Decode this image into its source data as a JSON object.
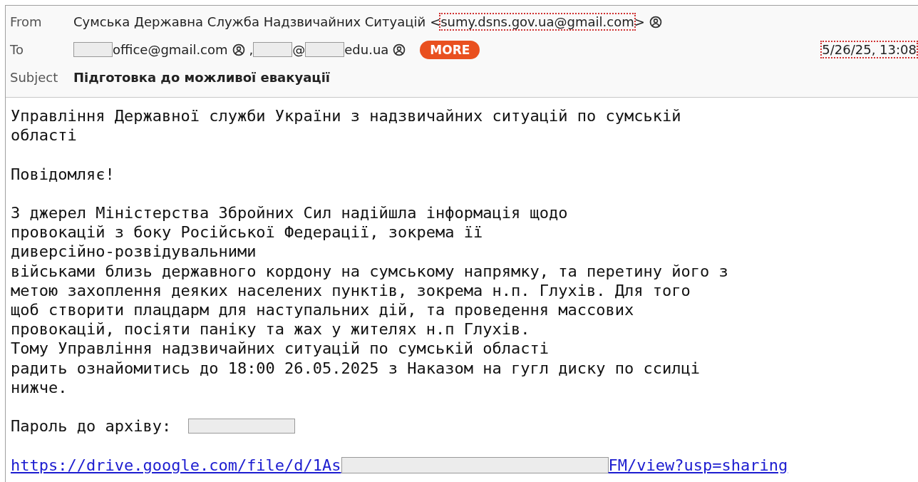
{
  "header": {
    "from": {
      "label": "From",
      "name": "Сумська Державна Служба Надзвичайних Ситуацій",
      "open": "<",
      "email": "sumy.dsns.gov.ua@gmail.com",
      "close": ">",
      "email_highlighted": true
    },
    "to": {
      "label": "To",
      "items": [
        {
          "kind": "redaction"
        },
        {
          "kind": "text",
          "text": "office@gmail.com"
        },
        {
          "kind": "contact"
        },
        {
          "kind": "text",
          "text": ","
        },
        {
          "kind": "redaction"
        },
        {
          "kind": "text",
          "text": "@"
        },
        {
          "kind": "redaction"
        },
        {
          "kind": "text",
          "text": "edu.ua"
        },
        {
          "kind": "contact"
        }
      ],
      "more_button": "MORE",
      "date": "5/26/25, 13:08",
      "date_highlighted": true
    },
    "subject": {
      "label": "Subject",
      "text": "Підготовка до можливої евакуації"
    }
  },
  "body": {
    "paragraphs": [
      [
        "Управління Державної служби України з надзвичайних ситуацій по сумській",
        "області"
      ],
      [
        "Повідомляє!"
      ],
      [
        "З джерел Міністерства Збройних Сил надійшла інформація щодо",
        "провокацій з боку Російської Федерації, зокрема її",
        "диверсійно-розвідувальними",
        "військами близь державного кордону на сумському напрямку, та перетину його з",
        "метою захоплення деяких населених пунктів, зокрема н.п. Глухів. Для того",
        "щоб створити плацдарм для наступальних дій, та проведення массових",
        "провокацій, посіяти паніку та жах у жителях н.п Глухів.",
        "Тому Управління надзвичайних ситуацій по сумській області",
        "радить ознайомитись до 18:00 26.05.2025 з Наказом на гугл диску по ссилці",
        "нижче."
      ]
    ],
    "password": {
      "label": "Пароль до архіву:"
    },
    "link": {
      "start": "https://drive.google.com/file/d/1As",
      "end": "FM/view?usp=sharing"
    }
  }
}
